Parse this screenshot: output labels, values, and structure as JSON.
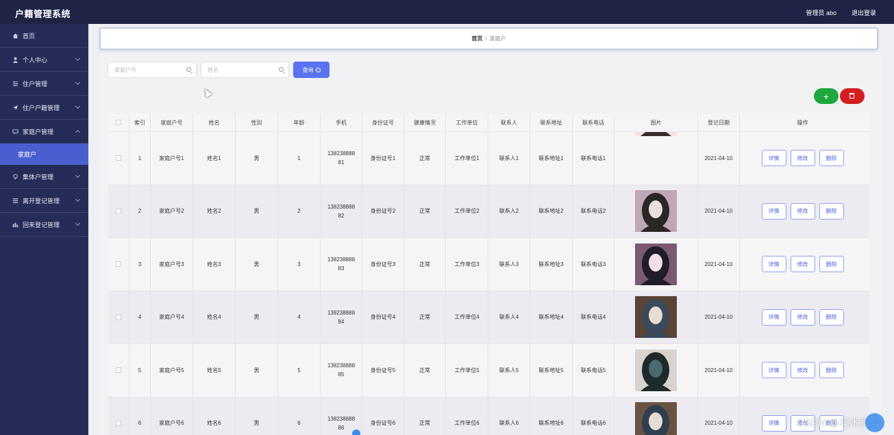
{
  "header": {
    "title": "户籍管理系统",
    "user_label": "管理员 abo",
    "logout_label": "退出登录"
  },
  "sidebar": {
    "items": [
      {
        "label": "首页",
        "icon": "home-icon",
        "has_chevron": false
      },
      {
        "label": "个人中心",
        "icon": "user-icon",
        "has_chevron": true
      },
      {
        "label": "住户管理",
        "icon": "sliders-icon",
        "has_chevron": true
      },
      {
        "label": "住户户籍管理",
        "icon": "send-icon",
        "has_chevron": true
      },
      {
        "label": "家庭户管理",
        "icon": "chat-icon",
        "has_chevron": true,
        "expanded": true
      },
      {
        "label": "集体户管理",
        "icon": "bulb-icon",
        "has_chevron": true
      },
      {
        "label": "离开登记管理",
        "icon": "menu-icon",
        "has_chevron": true
      },
      {
        "label": "回来登记管理",
        "icon": "chart-icon",
        "has_chevron": true
      }
    ],
    "sub_item": "家庭户"
  },
  "breadcrumb": {
    "home": "首页",
    "separator": "/",
    "current": "家庭户"
  },
  "search": {
    "household_placeholder": "家庭户号",
    "name_placeholder": "姓名",
    "button_label": "查询"
  },
  "actions": {
    "add_symbol": "+"
  },
  "table": {
    "headers": [
      "",
      "索引",
      "家庭户号",
      "姓名",
      "性别",
      "年龄",
      "手机",
      "身份证号",
      "健康情况",
      "工作单位",
      "联系人",
      "联系地址",
      "联系电话",
      "图片",
      "登记日期",
      "操作"
    ],
    "rows": [
      {
        "index": "1",
        "household": "家庭户号1",
        "name": "姓名1",
        "gender": "男",
        "age": "1",
        "phone": "13823888881",
        "id_card": "身份证号1",
        "health": "正常",
        "work": "工作单位1",
        "contact": "联系人1",
        "address": "联系地址1",
        "tel": "联系电话1",
        "date": "2021-04-10"
      },
      {
        "index": "2",
        "household": "家庭户号2",
        "name": "姓名2",
        "gender": "男",
        "age": "2",
        "phone": "13823888882",
        "id_card": "身份证号2",
        "health": "正常",
        "work": "工作单位2",
        "contact": "联系人2",
        "address": "联系地址2",
        "tel": "联系电话2",
        "date": "2021-04-10"
      },
      {
        "index": "3",
        "household": "家庭户号3",
        "name": "姓名3",
        "gender": "男",
        "age": "3",
        "phone": "13823888883",
        "id_card": "身份证号3",
        "health": "正常",
        "work": "工作单位3",
        "contact": "联系人3",
        "address": "联系地址3",
        "tel": "联系电话3",
        "date": "2021-04-10"
      },
      {
        "index": "4",
        "household": "家庭户号4",
        "name": "姓名4",
        "gender": "男",
        "age": "4",
        "phone": "13823888884",
        "id_card": "身份证号4",
        "health": "正常",
        "work": "工作单位4",
        "contact": "联系人4",
        "address": "联系地址4",
        "tel": "联系电话4",
        "date": "2021-04-10"
      },
      {
        "index": "5",
        "household": "家庭户号5",
        "name": "姓名5",
        "gender": "男",
        "age": "5",
        "phone": "13823888885",
        "id_card": "身份证号5",
        "health": "正常",
        "work": "工作单位5",
        "contact": "联系人5",
        "address": "联系地址5",
        "tel": "联系电话5",
        "date": "2021-04-10"
      },
      {
        "index": "6",
        "household": "家庭户号6",
        "name": "姓名6",
        "gender": "男",
        "age": "6",
        "phone": "13823888886",
        "id_card": "身份证号6",
        "health": "正常",
        "work": "工作单位6",
        "contact": "联系人6",
        "address": "联系地址6",
        "tel": "联系电话6",
        "date": "2021-04-10"
      }
    ],
    "row_buttons": {
      "detail": "详情",
      "edit": "修改",
      "delete": "删除"
    }
  },
  "watermark": "CSDN @巧木科技",
  "colors": {
    "topbar": "#1f2446",
    "sidebar": "#252c58",
    "active": "#4a5fcf",
    "primary": "#5a73f0",
    "add": "#1fa83e",
    "delete": "#d21f1f"
  }
}
